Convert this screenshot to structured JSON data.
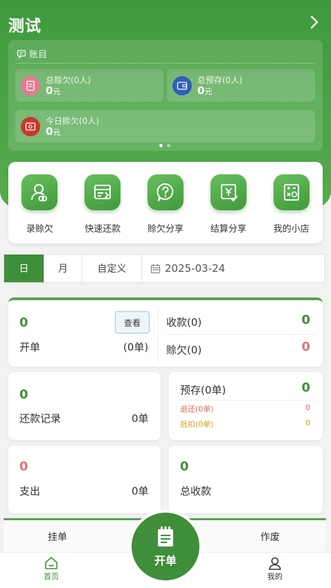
{
  "header": {
    "title": "测试"
  },
  "ledger": {
    "heading": "账目",
    "stats": [
      {
        "label": "总赊欠(0人)",
        "value": "0",
        "unit": "元",
        "icon": "document-icon",
        "color": "#e27a92"
      },
      {
        "label": "总预存(0人)",
        "value": "0",
        "unit": "元",
        "icon": "wallet-icon",
        "color": "#2f5fb8"
      },
      {
        "label": "今日赊欠(0人)",
        "value": "0",
        "unit": "元",
        "icon": "ticket-icon",
        "color": "#c7392f"
      }
    ],
    "carousel": {
      "pages": 2,
      "active": 0
    }
  },
  "quick_actions": [
    {
      "label": "录赊欠",
      "icon": "user-record-icon"
    },
    {
      "label": "快速还款",
      "icon": "quick-repay-icon"
    },
    {
      "label": "赊欠分享",
      "icon": "question-share-icon"
    },
    {
      "label": "结算分享",
      "icon": "yen-check-icon"
    },
    {
      "label": "我的小店",
      "icon": "shop-calculator-icon"
    }
  ],
  "date_filter": {
    "tabs": [
      "日",
      "月",
      "自定义"
    ],
    "active": "日",
    "date": "2025-03-24",
    "icon": "calendar-icon"
  },
  "summary": {
    "orders": {
      "count": "0",
      "label": "开单",
      "sub": "(0单)",
      "view_button": "查看"
    },
    "received": {
      "label": "收款(0)",
      "value": "0"
    },
    "credit": {
      "label": "赊欠(0)",
      "value": "0"
    },
    "repay": {
      "count": "0",
      "label": "还款记录",
      "sub": "0单"
    },
    "deposit": {
      "label": "预存(0单)",
      "value": "0",
      "refund_label": "退还(0单)",
      "refund_value": "0",
      "deduct_label": "抵扣(0单)",
      "deduct_value": "0"
    },
    "expense": {
      "count": "0",
      "label": "支出",
      "sub": "0单"
    },
    "total": {
      "count": "0",
      "label": "总收款"
    }
  },
  "bottom_tabs": {
    "left": "挂单",
    "right": "作废"
  },
  "fab": {
    "label": "开单",
    "icon": "notepad-icon"
  },
  "nav": {
    "home": "首页",
    "mine": "我的",
    "home_icon": "home-icon",
    "mine_icon": "person-icon"
  },
  "colors": {
    "primary": "#3f8e39",
    "accent_red": "#e57373",
    "orange": "#e0a020",
    "refund_red": "#e06a5a"
  }
}
